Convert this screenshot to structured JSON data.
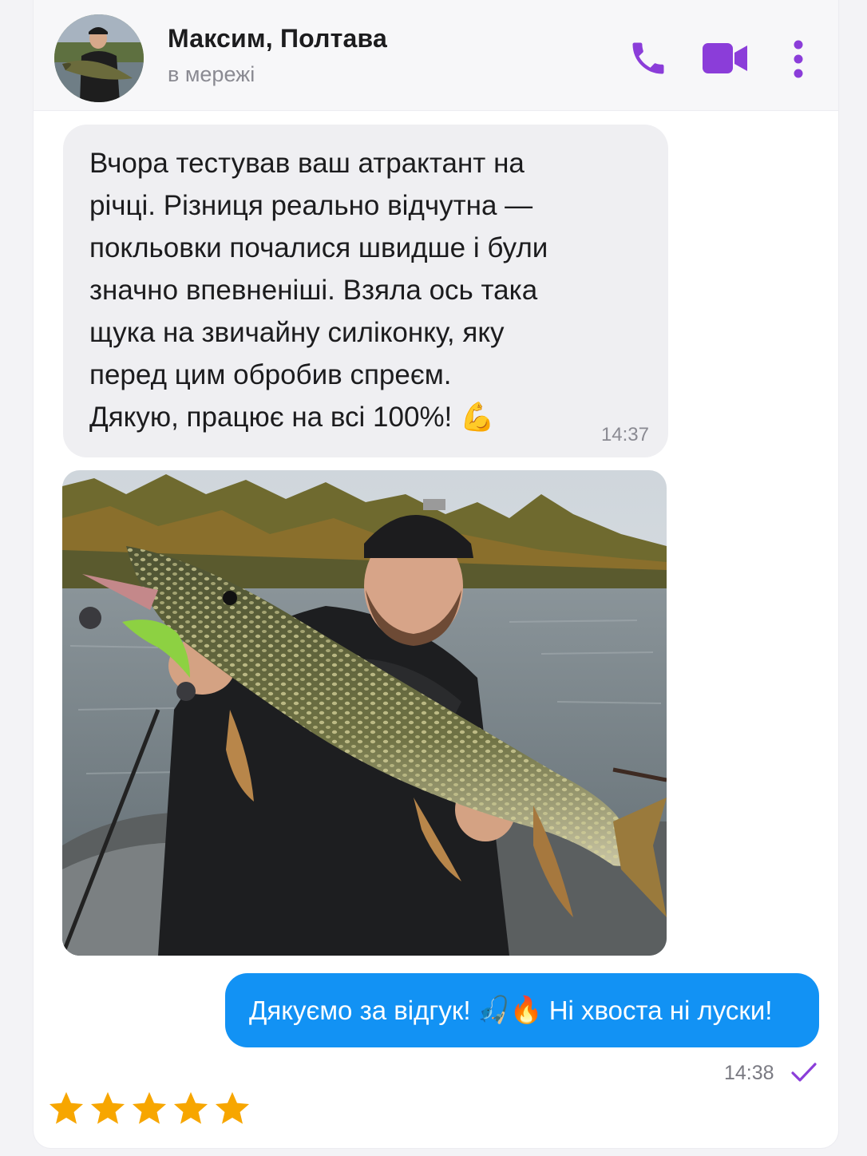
{
  "header": {
    "contact_name": "Максим, Полтава",
    "status": "в мережі",
    "icons": [
      "phone-icon",
      "video-camera-icon",
      "more-vertical-icon"
    ]
  },
  "messages": {
    "incoming_text": "Вчора тестував ваш атрактант на\nрічці. Різниця реально відчутна —\nпокльовки почалися швидше і були\nзначно впевненіші. Взяла ось така\nщука на звичайну силіконку, яку\nперед цим обробив спреєм.\nДякую, працює на всі 100%! 💪",
    "incoming_time": "14:37",
    "photo_description_icon": "photo-pike-catch",
    "outgoing_text_before": "Дякуємо за відгук!",
    "outgoing_emojis": "🎣🔥",
    "outgoing_text_after": "Ні хвоста ні луски!",
    "outgoing_time": "14:38"
  },
  "rating": {
    "stars": 5,
    "max": 5
  },
  "colors": {
    "accent": "#8b3dd9",
    "outgoing_bubble": "#1292f4",
    "incoming_bubble": "#efeff2",
    "star": "#f7a600"
  }
}
